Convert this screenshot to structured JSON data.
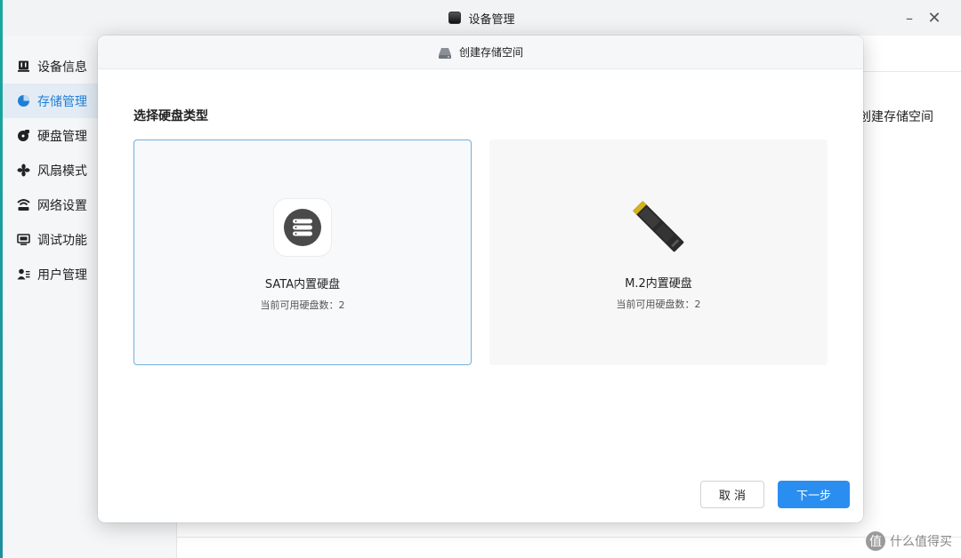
{
  "window": {
    "title": "设备管理",
    "minimize_glyph": "–",
    "close_glyph": "✕"
  },
  "sidebar": {
    "items": [
      {
        "label": "设备信息",
        "icon": "device-info-icon",
        "active": false
      },
      {
        "label": "存储管理",
        "icon": "storage-pie-icon",
        "active": true
      },
      {
        "label": "硬盘管理",
        "icon": "disk-icon",
        "active": false
      },
      {
        "label": "风扇模式",
        "icon": "fan-icon",
        "active": false
      },
      {
        "label": "网络设置",
        "icon": "network-icon",
        "active": false
      },
      {
        "label": "调试功能",
        "icon": "debug-icon",
        "active": false
      },
      {
        "label": "用户管理",
        "icon": "users-icon",
        "active": false
      }
    ]
  },
  "main": {
    "right_action_label": "创建存储空间"
  },
  "dialog": {
    "title": "创建存储空间",
    "section_title": "选择硬盘类型",
    "options": [
      {
        "name": "SATA内置硬盘",
        "count_text": "当前可用硬盘数：2",
        "selected": true
      },
      {
        "name": "M.2内置硬盘",
        "count_text": "当前可用硬盘数：2",
        "selected": false
      }
    ],
    "cancel_label": "取 消",
    "next_label": "下一步"
  },
  "watermark": {
    "glyph": "值",
    "text": "什么值得买"
  },
  "colors": {
    "accent": "#2a8ef0",
    "active_text": "#1f7fd6",
    "selected_border": "#6fb0e0"
  }
}
